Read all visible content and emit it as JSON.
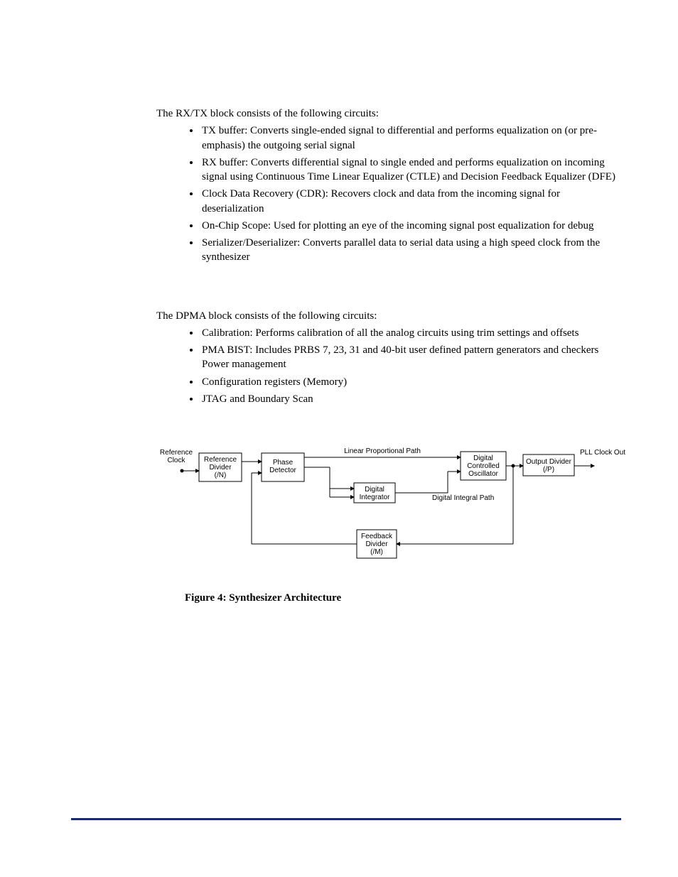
{
  "section1": {
    "intro": "The RX/TX block consists of the following circuits:",
    "items": [
      "TX buffer: Converts single-ended signal to differential and performs equalization on (or pre-emphasis) the outgoing serial signal",
      "RX buffer: Converts differential signal to single ended and performs equalization on incoming signal using Continuous Time Linear Equalizer (CTLE) and Decision Feedback Equalizer (DFE)",
      "Clock Data Recovery (CDR): Recovers clock and data from the incoming signal for deserialization",
      "On-Chip Scope: Used for plotting an eye of the incoming signal post equalization for debug",
      "Serializer/Deserializer: Converts parallel data to serial data using a high speed clock from the synthesizer"
    ]
  },
  "section2": {
    "intro": "The DPMA block consists of the following circuits:",
    "items": [
      "Calibration: Performs calibration of all the analog circuits using trim settings and offsets",
      "PMA BIST: Includes PRBS 7, 23, 31 and 40-bit user defined pattern generators and checkers Power management",
      "Configuration registers (Memory)",
      "JTAG and Boundary Scan"
    ]
  },
  "figure": {
    "caption": "Figure 4: Synthesizer Architecture",
    "labels": {
      "ref_clock": "Reference\nClock",
      "ref_div": "Reference\nDivider\n(/N)",
      "phase_det": "Phase\nDetector",
      "lin_path": "Linear Proportional Path",
      "dig_int": "Digital\nIntegrator",
      "dig_int_path": "Digital Integral Path",
      "dco": "Digital\nControlled\nOscillator",
      "out_div": "Output Divider\n(/P)",
      "pll_out": "PLL Clock Out",
      "fb_div": "Feedback\nDivider\n(/M)"
    }
  }
}
